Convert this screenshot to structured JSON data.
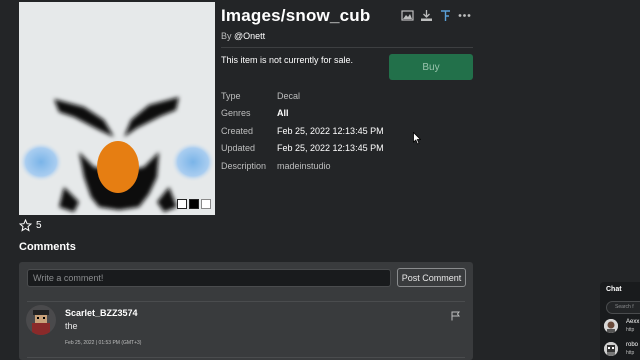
{
  "asset": {
    "title": "Images/snow_cub",
    "by_prefix": "By",
    "creator": "@Onett",
    "sale_status": "This item is not currently for sale.",
    "buy_label": "Buy",
    "favorites": "5"
  },
  "details": [
    {
      "label": "Type",
      "value": "Decal"
    },
    {
      "label": "Genres",
      "value": "All"
    },
    {
      "label": "Created",
      "value": "Feb 25, 2022 12:13:45 PM"
    },
    {
      "label": "Updated",
      "value": "Feb 25, 2022 12:13:45 PM"
    },
    {
      "label": "Description",
      "value": "madeinstudio"
    }
  ],
  "toolbar_icons": [
    "image-icon",
    "download-icon",
    "tree-icon",
    "more-icon"
  ],
  "comments": {
    "title": "Comments",
    "placeholder": "Write a comment!",
    "post_label": "Post Comment",
    "items": [
      {
        "user": "Scarlet_BZZ3574",
        "text": "the",
        "time": "Feb 25, 2022 | 01:53 PM (GMT+3)"
      }
    ]
  },
  "chat": {
    "title": "Chat",
    "search_placeholder": "Search f",
    "items": [
      {
        "name": "Aexx",
        "sub": "http"
      },
      {
        "name": "robo",
        "sub": "http"
      }
    ]
  },
  "colors": {
    "background": "#232527",
    "buy_button": "#22704a",
    "panel": "#393b3d"
  }
}
